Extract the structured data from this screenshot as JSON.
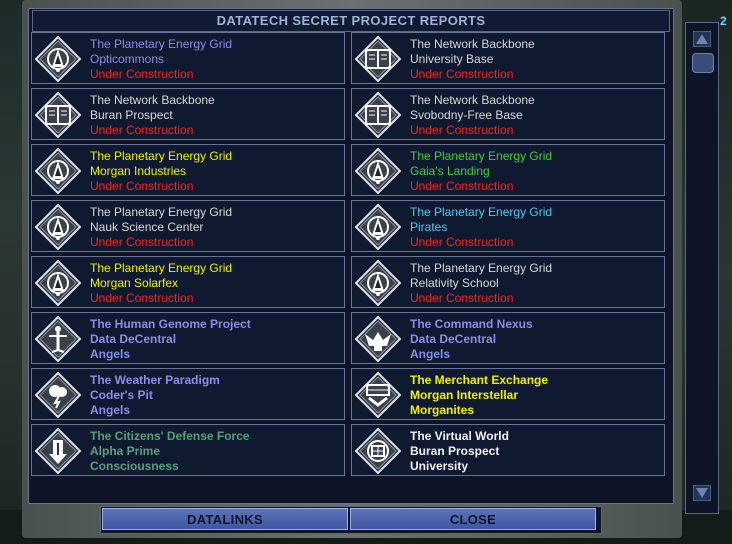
{
  "window": {
    "title": "DATATECH SECRET PROJECT REPORTS"
  },
  "corner_badge": "2",
  "colors": {
    "gray": "#d8d8d8",
    "red": "#ff2020",
    "purple": "#8a8ee8",
    "yellow": "#f0f000",
    "green": "#44cc44",
    "cyan": "#55c8ee",
    "teal": "#5aa07a",
    "white": "#f2f2f2"
  },
  "projects": [
    {
      "icon": "energy-grid-icon",
      "bold": false,
      "lines": [
        {
          "text": "The Planetary Energy Grid",
          "color": "#8a8ee8"
        },
        {
          "text": "Opticommons",
          "color": "#8a8ee8"
        },
        {
          "text": "Under Construction",
          "color": "#ff2020"
        }
      ]
    },
    {
      "icon": "network-backbone-icon",
      "bold": false,
      "lines": [
        {
          "text": "The Network Backbone",
          "color": "#d8d8d8"
        },
        {
          "text": "University Base",
          "color": "#d8d8d8"
        },
        {
          "text": "Under Construction",
          "color": "#ff2020"
        }
      ]
    },
    {
      "icon": "network-backbone-icon",
      "bold": false,
      "lines": [
        {
          "text": "The Network Backbone",
          "color": "#d8d8d8"
        },
        {
          "text": "Buran Prospect",
          "color": "#d8d8d8"
        },
        {
          "text": "Under Construction",
          "color": "#ff2020"
        }
      ]
    },
    {
      "icon": "network-backbone-icon",
      "bold": false,
      "lines": [
        {
          "text": "The Network Backbone",
          "color": "#d8d8d8"
        },
        {
          "text": "Svobodny-Free Base",
          "color": "#d8d8d8"
        },
        {
          "text": "Under Construction",
          "color": "#ff2020"
        }
      ]
    },
    {
      "icon": "energy-grid-icon",
      "bold": false,
      "lines": [
        {
          "text": "The Planetary Energy Grid",
          "color": "#f0f000"
        },
        {
          "text": "Morgan Industries",
          "color": "#f0f000"
        },
        {
          "text": "Under Construction",
          "color": "#ff2020"
        }
      ]
    },
    {
      "icon": "energy-grid-icon",
      "bold": false,
      "lines": [
        {
          "text": "The Planetary Energy Grid",
          "color": "#44cc44"
        },
        {
          "text": "Gaia's Landing",
          "color": "#44cc44"
        },
        {
          "text": "Under Construction",
          "color": "#ff2020"
        }
      ]
    },
    {
      "icon": "energy-grid-icon",
      "bold": false,
      "lines": [
        {
          "text": "The Planetary Energy Grid",
          "color": "#d8d8d8"
        },
        {
          "text": "Nauk Science Center",
          "color": "#d8d8d8"
        },
        {
          "text": "Under Construction",
          "color": "#ff2020"
        }
      ]
    },
    {
      "icon": "energy-grid-icon",
      "bold": false,
      "lines": [
        {
          "text": "The Planetary Energy Grid",
          "color": "#55c8ee"
        },
        {
          "text": "Pirates",
          "color": "#55c8ee"
        },
        {
          "text": "Under Construction",
          "color": "#ff2020"
        }
      ]
    },
    {
      "icon": "energy-grid-icon",
      "bold": false,
      "lines": [
        {
          "text": "The Planetary Energy Grid",
          "color": "#f0f000"
        },
        {
          "text": "Morgan Solarfex",
          "color": "#f0f000"
        },
        {
          "text": "Under Construction",
          "color": "#ff2020"
        }
      ]
    },
    {
      "icon": "energy-grid-icon",
      "bold": false,
      "lines": [
        {
          "text": "The Planetary Energy Grid",
          "color": "#d8d8d8"
        },
        {
          "text": "Relativity School",
          "color": "#d8d8d8"
        },
        {
          "text": "Under Construction",
          "color": "#ff2020"
        }
      ]
    },
    {
      "icon": "human-genome-icon",
      "bold": true,
      "lines": [
        {
          "text": "The Human Genome Project",
          "color": "#8a8ee8"
        },
        {
          "text": "Data DeCentral",
          "color": "#8a8ee8"
        },
        {
          "text": "Angels",
          "color": "#8a8ee8"
        }
      ]
    },
    {
      "icon": "command-nexus-icon",
      "bold": true,
      "lines": [
        {
          "text": "The Command Nexus",
          "color": "#8a8ee8"
        },
        {
          "text": "Data DeCentral",
          "color": "#8a8ee8"
        },
        {
          "text": "Angels",
          "color": "#8a8ee8"
        }
      ]
    },
    {
      "icon": "weather-paradigm-icon",
      "bold": true,
      "lines": [
        {
          "text": "The Weather Paradigm",
          "color": "#8a8ee8"
        },
        {
          "text": "Coder's Pit",
          "color": "#8a8ee8"
        },
        {
          "text": "Angels",
          "color": "#8a8ee8"
        }
      ]
    },
    {
      "icon": "merchant-exchange-icon",
      "bold": true,
      "lines": [
        {
          "text": "The Merchant Exchange",
          "color": "#f0f000"
        },
        {
          "text": "Morgan Interstellar",
          "color": "#f0f000"
        },
        {
          "text": "Morganites",
          "color": "#f0f000"
        }
      ]
    },
    {
      "icon": "citizens-defense-icon",
      "bold": true,
      "lines": [
        {
          "text": "The Citizens' Defense Force",
          "color": "#5aa07a"
        },
        {
          "text": "Alpha Prime",
          "color": "#5aa07a"
        },
        {
          "text": "Consciousness",
          "color": "#5aa07a"
        }
      ]
    },
    {
      "icon": "virtual-world-icon",
      "bold": true,
      "lines": [
        {
          "text": "The Virtual World",
          "color": "#f2f2f2"
        },
        {
          "text": "Buran Prospect",
          "color": "#f2f2f2"
        },
        {
          "text": "University",
          "color": "#f2f2f2"
        }
      ]
    }
  ],
  "buttons": {
    "datalinks": "DATALINKS",
    "close": "CLOSE"
  }
}
